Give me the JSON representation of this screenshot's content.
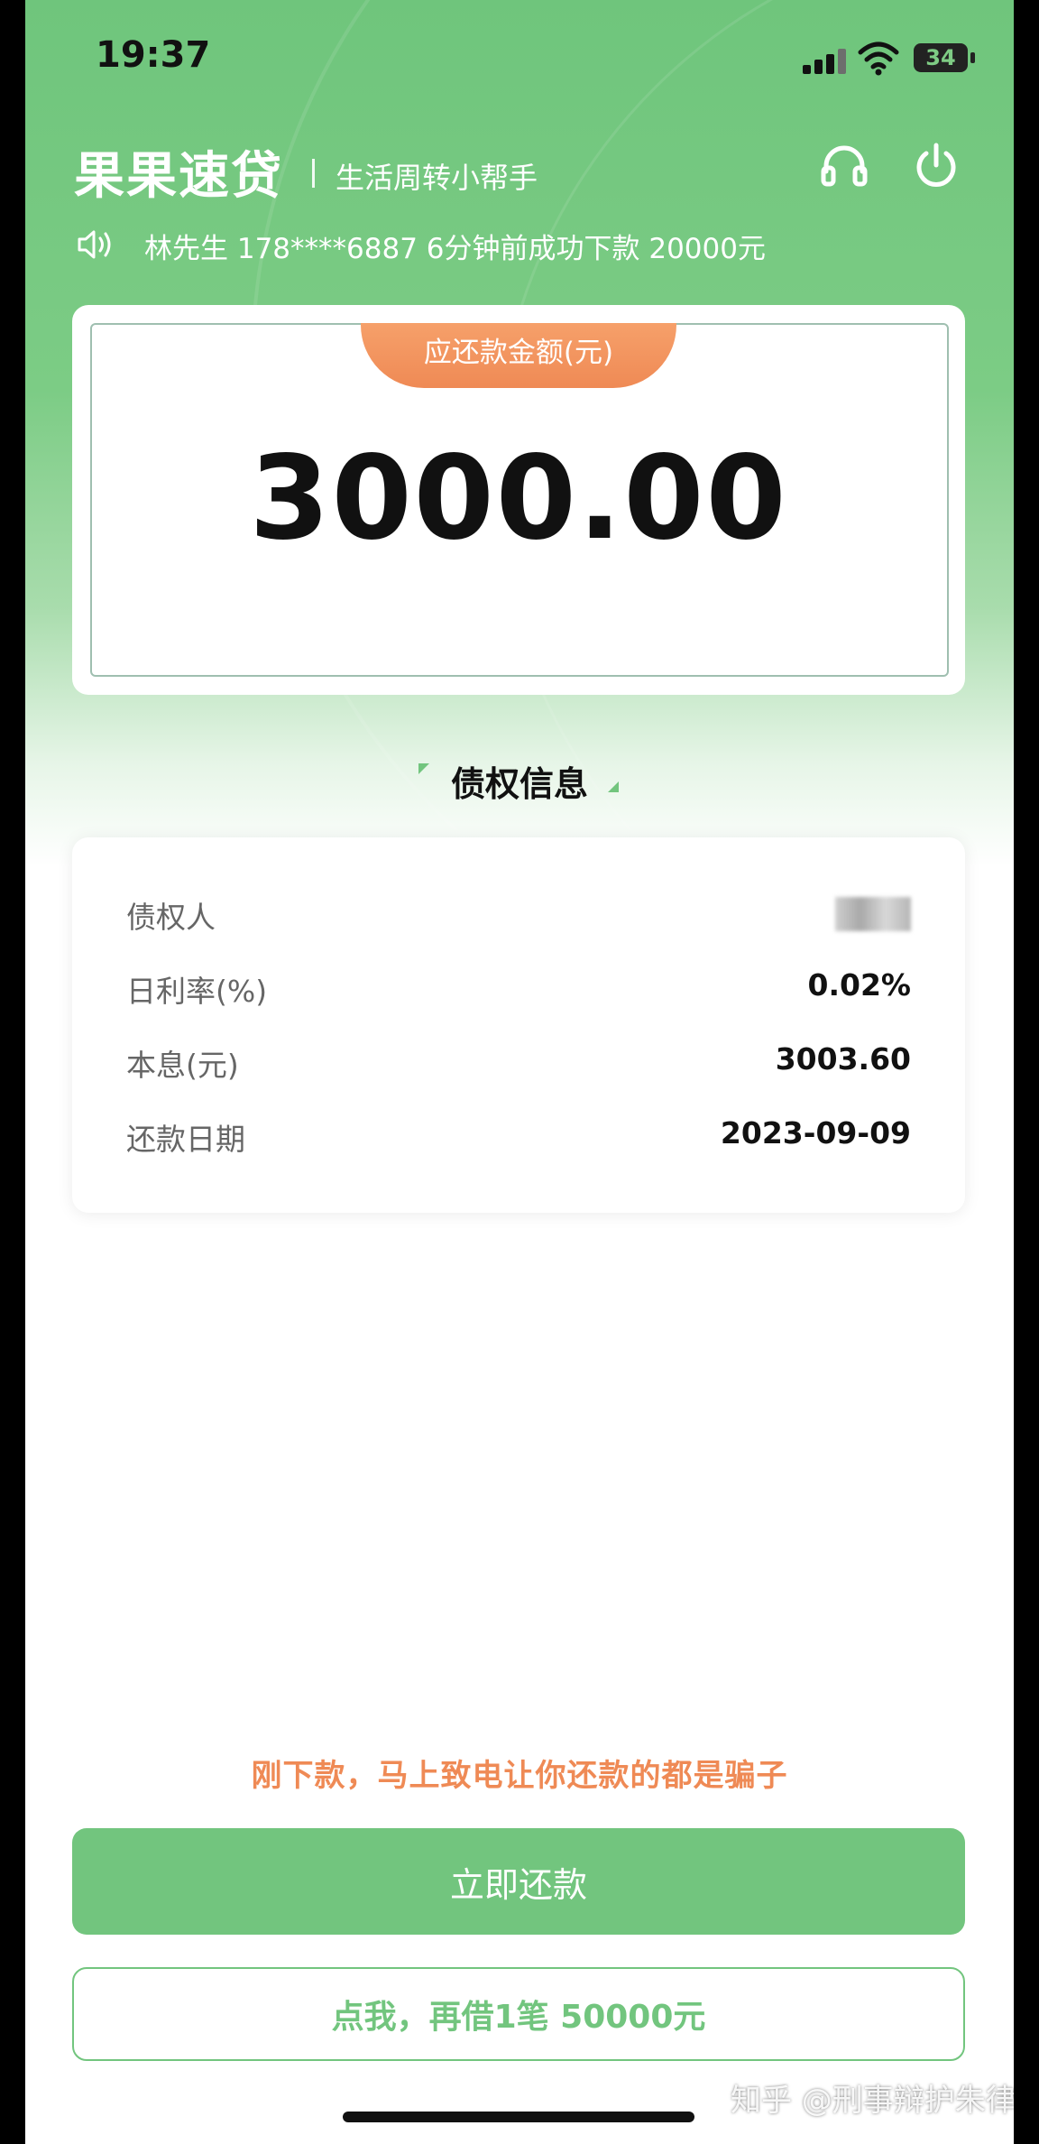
{
  "status_bar": {
    "time": "19:37",
    "battery": "34"
  },
  "header": {
    "app_name": "果果速贷",
    "tagline": "生活周转小帮手",
    "notice": "林先生 178****6887 6分钟前成功下款 20000元"
  },
  "amount_card": {
    "label": "应还款金额(元)",
    "value": "3000.00"
  },
  "section_title": "债权信息",
  "info": {
    "rows": [
      {
        "label": "债权人",
        "value": ""
      },
      {
        "label": "日利率(%)",
        "value": "0.02%"
      },
      {
        "label": "本息(元)",
        "value": "3003.60"
      },
      {
        "label": "还款日期",
        "value": "2023-09-09"
      }
    ]
  },
  "warning": "刚下款，马上致电让你还款的都是骗子",
  "buttons": {
    "repay": "立即还款",
    "borrow": "点我，再借1笔 50000元"
  },
  "watermark": "知乎 @刑事辩护朱律",
  "colors": {
    "brand_green": "#72c57e",
    "accent_orange": "#ef8a55"
  }
}
